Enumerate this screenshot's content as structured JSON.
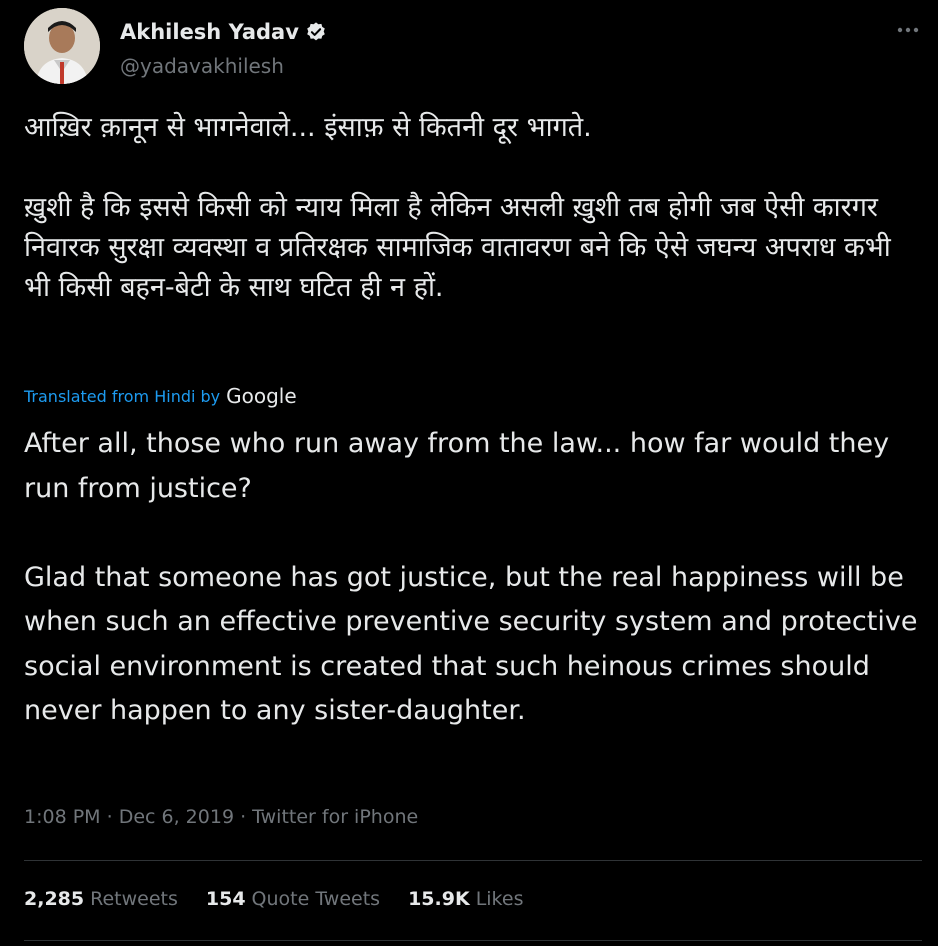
{
  "author": {
    "display_name": "Akhilesh Yadav",
    "handle": "@yadavakhilesh",
    "avatar_icon": "profile-photo",
    "verified_icon": "verified-badge-icon"
  },
  "tweet": {
    "hindi_text": "आख़िर क़ानून से भागनेवाले... इंसाफ़ से कितनी दूर भागते.\n\nख़ुशी है कि इससे किसी को न्याय मिला है लेकिन असली ख़ुशी तब होगी जब ऐसी कारगर निवारक सुरक्षा व्यवस्था व प्रतिरक्षक सामाजिक वातावरण बने कि ऐसे जघन्य अपराध कभी भी किसी बहन-बेटी के साथ घटित ही न हों.",
    "translated_label": "Translated from Hindi by",
    "translator": "Google",
    "english_text": "After all, those who run away from the law... how far would they run from justice?\n\n Glad that someone has got justice, but the real happiness will be when such an effective preventive security system and protective social environment is created that such heinous crimes should never happen to any sister-daughter.",
    "time": "1:08 PM",
    "date": "Dec 6, 2019",
    "source": "Twitter for iPhone"
  },
  "stats": {
    "retweets_count": "2,285",
    "retweets_label": "Retweets",
    "quotes_count": "154",
    "quotes_label": "Quote Tweets",
    "likes_count": "15.9K",
    "likes_label": "Likes"
  },
  "colors": {
    "background": "#000000",
    "text_primary": "#e7e9ea",
    "text_secondary": "#71767b",
    "accent": "#1d9bf0"
  }
}
